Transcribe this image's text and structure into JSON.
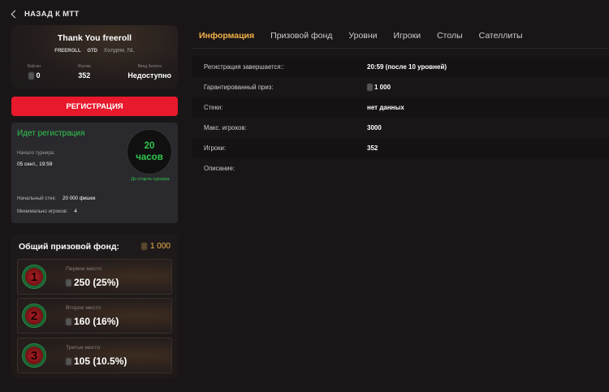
{
  "back": {
    "label": "НАЗАД К МТТ"
  },
  "tournament": {
    "title": "Thank You freeroll",
    "tags": [
      "FREEROLL",
      "GTD"
    ],
    "game": "Холдем, NL",
    "stats": [
      {
        "label": "Бай-ин",
        "value": "0"
      },
      {
        "label": "Игроки",
        "value": "352"
      },
      {
        "label": "Ввод билета",
        "value": "Недоступно"
      }
    ]
  },
  "register_button": "РЕГИСТРАЦИЯ",
  "registration": {
    "status": "Идет регистрация",
    "start_label": "Начало турнира:",
    "start_value": "05 сент., 19:59",
    "timer_value": "20",
    "timer_unit": "часов",
    "timer_caption": "До старта турнира",
    "stack_label": "Начальный стек:",
    "stack_value": "20 000 фишек",
    "min_players_label": "Минимально игроков:",
    "min_players_value": "4"
  },
  "prize_pool": {
    "title": "Общий призовой фонд:",
    "total": "1 000",
    "places": [
      {
        "number": "1",
        "label": "Первое место",
        "value": "250 (25%)"
      },
      {
        "number": "2",
        "label": "Второе место",
        "value": "160 (16%)"
      },
      {
        "number": "3",
        "label": "Третье место",
        "value": "105 (10.5%)"
      }
    ]
  },
  "tabs": [
    "Информация",
    "Призовой фонд",
    "Уровни",
    "Игроки",
    "Столы",
    "Сателлиты"
  ],
  "info": [
    {
      "key": "Регистрация завершается::",
      "value": "20:59 (после 10 уровней)"
    },
    {
      "key": "Гарантированный приз:",
      "value": "1 000"
    },
    {
      "key": "Стеки:",
      "value": "нет данных"
    },
    {
      "key": "Макс. игроков:",
      "value": "3000"
    },
    {
      "key": "Игроки:",
      "value": "352"
    },
    {
      "key": "Описание:",
      "value": ""
    }
  ],
  "colors": {
    "accent": "#f1b24a",
    "register": "#e8192c",
    "status_green": "#2fc74d"
  }
}
